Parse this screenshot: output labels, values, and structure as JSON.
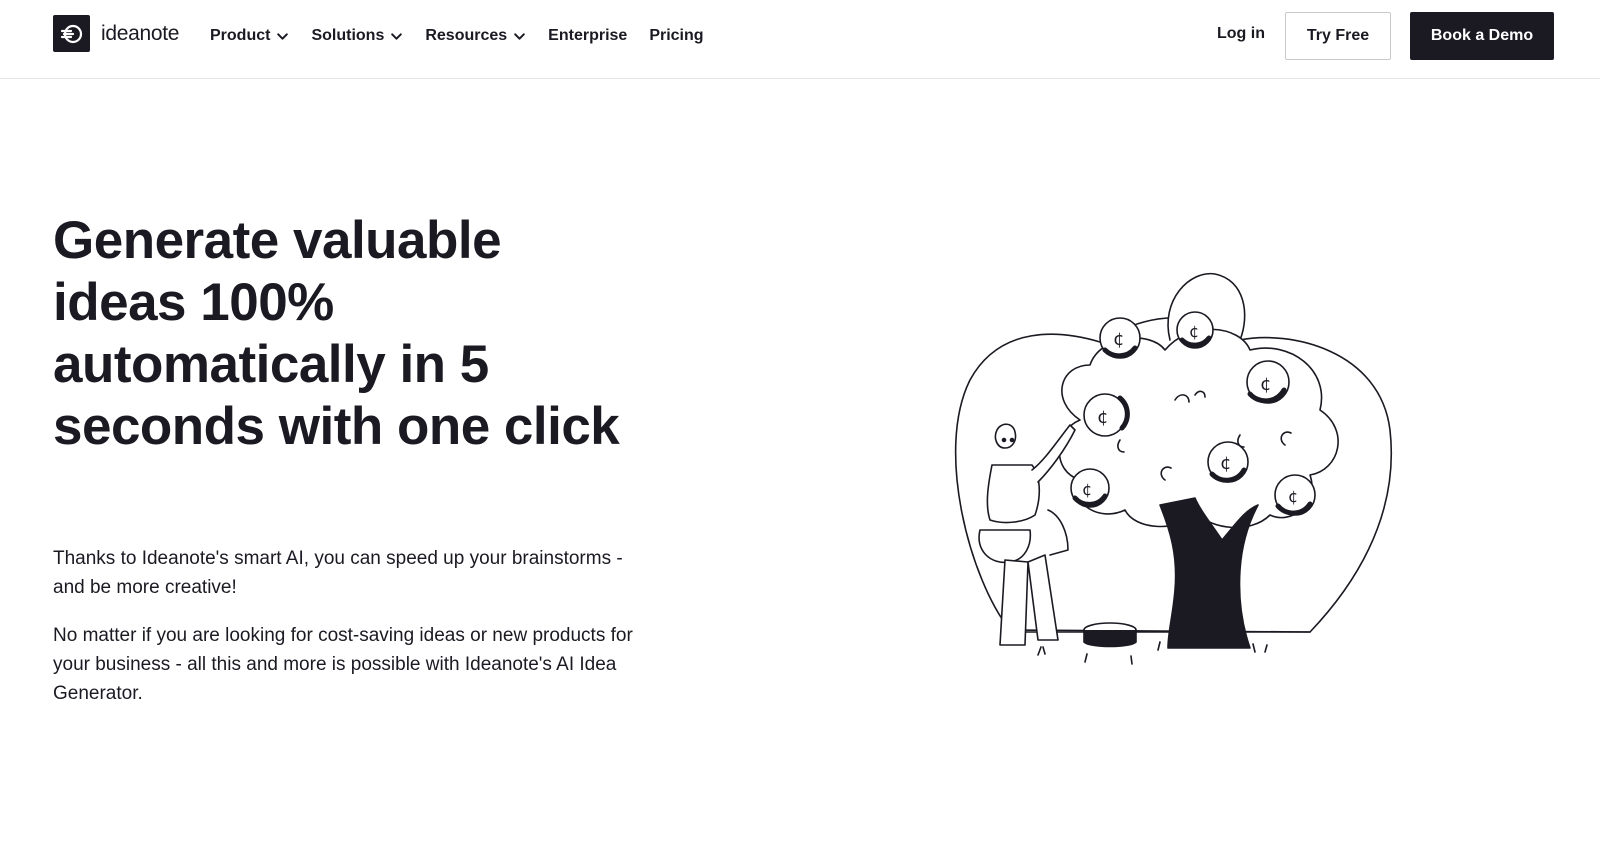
{
  "header": {
    "brand": "ideanote",
    "nav": [
      {
        "label": "Product",
        "has_dropdown": true
      },
      {
        "label": "Solutions",
        "has_dropdown": true
      },
      {
        "label": "Resources",
        "has_dropdown": true
      },
      {
        "label": "Enterprise",
        "has_dropdown": false
      },
      {
        "label": "Pricing",
        "has_dropdown": false
      }
    ],
    "login_label": "Log in",
    "try_free_label": "Try Free",
    "book_demo_label": "Book a Demo"
  },
  "hero": {
    "title": "Generate valuable ideas 100% automatically in 5 seconds with one click",
    "paragraph_1": "Thanks to Ideanote's smart AI, you can speed up your brainstorms - and be more creative!",
    "paragraph_2": "No matter if you are looking for cost-saving ideas or new products for your business - all this and more is possible with Ideanote's AI Idea Generator."
  },
  "colors": {
    "ink": "#1b1a23",
    "background": "#ffffff",
    "border": "#e7e7ea"
  },
  "icons": {
    "logo": "ideanote-logo-icon",
    "dropdown": "chevron-down-icon",
    "illustration": "money-tree-illustration"
  }
}
